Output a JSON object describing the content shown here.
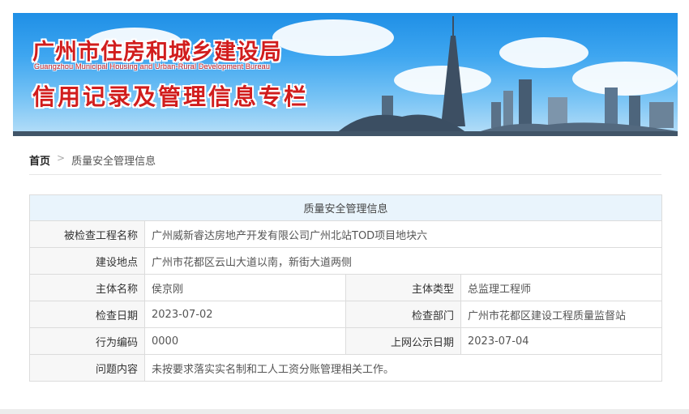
{
  "banner": {
    "title_cn": "广州市住房和城乡建设局",
    "title_en": "Guangzhou Municipal Housing and Urban-Rural Development Bureau",
    "subtitle": "信用记录及管理信息专栏"
  },
  "breadcrumb": {
    "home": "首页",
    "separator": ">",
    "current": "质量安全管理信息"
  },
  "table": {
    "caption": "质量安全管理信息",
    "project_name": {
      "label": "被检查工程名称",
      "value": "广州威新睿达房地产开发有限公司广州北站TOD项目地块六"
    },
    "location": {
      "label": "建设地点",
      "value": "广州市花都区云山大道以南，新街大道两侧"
    },
    "subject_name": {
      "label": "主体名称",
      "value": "侯京刚"
    },
    "subject_type": {
      "label": "主体类型",
      "value": "总监理工程师"
    },
    "check_date": {
      "label": "检查日期",
      "value": "2023-07-02"
    },
    "check_dept": {
      "label": "检查部门",
      "value": "广州市花都区建设工程质量监督站"
    },
    "behavior_code": {
      "label": "行为编码",
      "value": "0000"
    },
    "publish_date": {
      "label": "上网公示日期",
      "value": "2023-07-04"
    },
    "issue": {
      "label": "问题内容",
      "value": "未按要求落实实名制和工人工资分账管理相关工作。"
    }
  },
  "colors": {
    "title_red": "#d11d1d",
    "header_bg": "#e9f4fc",
    "label_bg": "#f7f7f7",
    "border": "#dcdcdc"
  }
}
